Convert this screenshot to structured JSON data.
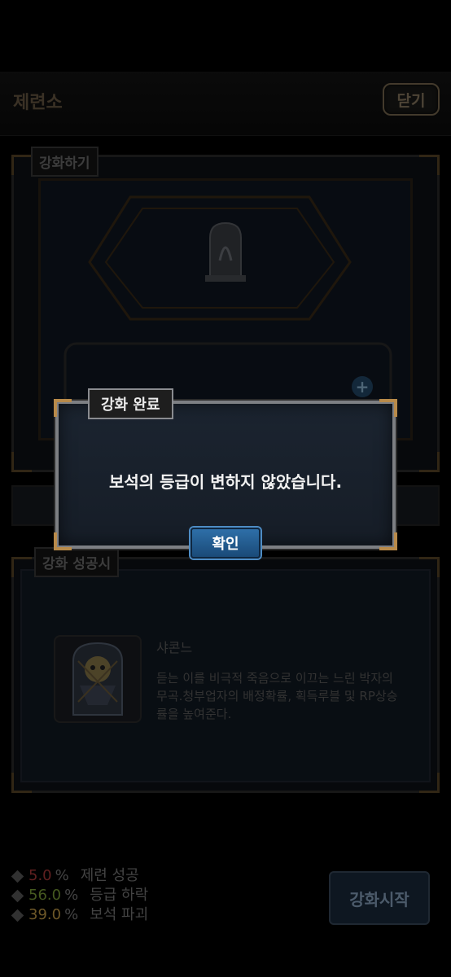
{
  "header": {
    "title": "제련소",
    "close_label": "닫기"
  },
  "enhance_panel": {
    "label": "강화하기"
  },
  "success_panel": {
    "label": "강화 성공시"
  },
  "item": {
    "name": "샤콘느",
    "description": "듣는 이를 비극적 죽음으로 이끄는 느린 박자의 무곡.청부업자의 배정확률, 획득루블 및 RP상승률을 높여준다."
  },
  "rates": [
    {
      "value": "5.0",
      "unit": "%",
      "label": "제련 성공",
      "color": "#b03a3a"
    },
    {
      "value": "56.0",
      "unit": "%",
      "label": "등급 하락",
      "color": "#7fa33a"
    },
    {
      "value": "39.0",
      "unit": "%",
      "label": "보석 파괴",
      "color": "#c9a04a"
    }
  ],
  "start_button_label": "강화시작",
  "modal": {
    "title": "강화 완료",
    "message": "보석의 등급이 변하지 않았습니다.",
    "confirm_label": "확인"
  }
}
